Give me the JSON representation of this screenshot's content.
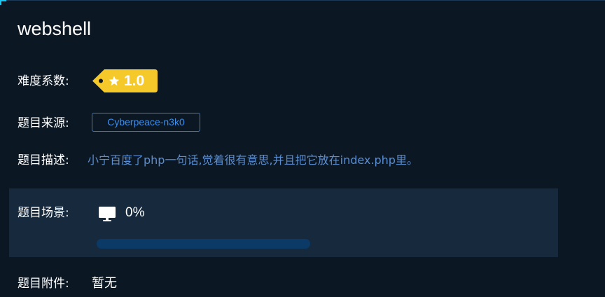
{
  "challenge": {
    "title": "webshell"
  },
  "difficulty": {
    "label": "难度系数:",
    "value": "1.0",
    "tag_color": "#f6c92b",
    "icon": "star-icon"
  },
  "source": {
    "label": "题目来源:",
    "value": "Cyberpeace-n3k0",
    "color": "#2f80d6"
  },
  "description": {
    "label": "题目描述:",
    "text": "小宁百度了php一句话,觉着很有意思,并且把它放在index.php里。"
  },
  "scene": {
    "label": "题目场景:",
    "icon": "monitor-icon",
    "progress_text": "0%",
    "progress_value": 0
  },
  "attachment": {
    "label": "题目附件:",
    "value": "暂无"
  }
}
